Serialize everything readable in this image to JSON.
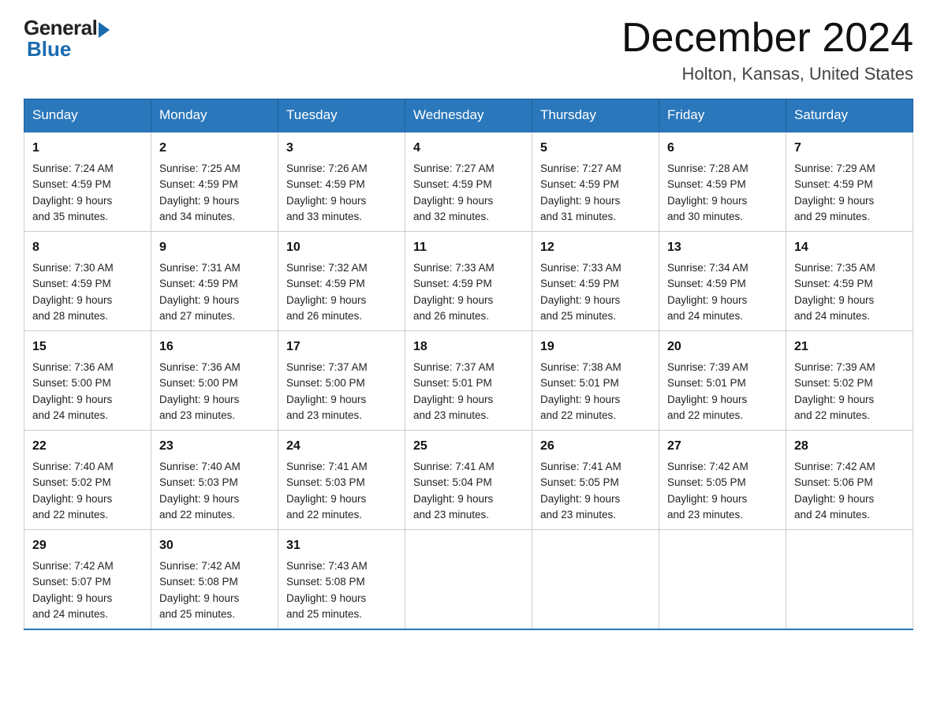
{
  "logo": {
    "general": "General",
    "blue": "Blue"
  },
  "header": {
    "month": "December 2024",
    "location": "Holton, Kansas, United States"
  },
  "days_of_week": [
    "Sunday",
    "Monday",
    "Tuesday",
    "Wednesday",
    "Thursday",
    "Friday",
    "Saturday"
  ],
  "weeks": [
    [
      {
        "day": "1",
        "sunrise": "7:24 AM",
        "sunset": "4:59 PM",
        "daylight": "9 hours and 35 minutes."
      },
      {
        "day": "2",
        "sunrise": "7:25 AM",
        "sunset": "4:59 PM",
        "daylight": "9 hours and 34 minutes."
      },
      {
        "day": "3",
        "sunrise": "7:26 AM",
        "sunset": "4:59 PM",
        "daylight": "9 hours and 33 minutes."
      },
      {
        "day": "4",
        "sunrise": "7:27 AM",
        "sunset": "4:59 PM",
        "daylight": "9 hours and 32 minutes."
      },
      {
        "day": "5",
        "sunrise": "7:27 AM",
        "sunset": "4:59 PM",
        "daylight": "9 hours and 31 minutes."
      },
      {
        "day": "6",
        "sunrise": "7:28 AM",
        "sunset": "4:59 PM",
        "daylight": "9 hours and 30 minutes."
      },
      {
        "day": "7",
        "sunrise": "7:29 AM",
        "sunset": "4:59 PM",
        "daylight": "9 hours and 29 minutes."
      }
    ],
    [
      {
        "day": "8",
        "sunrise": "7:30 AM",
        "sunset": "4:59 PM",
        "daylight": "9 hours and 28 minutes."
      },
      {
        "day": "9",
        "sunrise": "7:31 AM",
        "sunset": "4:59 PM",
        "daylight": "9 hours and 27 minutes."
      },
      {
        "day": "10",
        "sunrise": "7:32 AM",
        "sunset": "4:59 PM",
        "daylight": "9 hours and 26 minutes."
      },
      {
        "day": "11",
        "sunrise": "7:33 AM",
        "sunset": "4:59 PM",
        "daylight": "9 hours and 26 minutes."
      },
      {
        "day": "12",
        "sunrise": "7:33 AM",
        "sunset": "4:59 PM",
        "daylight": "9 hours and 25 minutes."
      },
      {
        "day": "13",
        "sunrise": "7:34 AM",
        "sunset": "4:59 PM",
        "daylight": "9 hours and 24 minutes."
      },
      {
        "day": "14",
        "sunrise": "7:35 AM",
        "sunset": "4:59 PM",
        "daylight": "9 hours and 24 minutes."
      }
    ],
    [
      {
        "day": "15",
        "sunrise": "7:36 AM",
        "sunset": "5:00 PM",
        "daylight": "9 hours and 24 minutes."
      },
      {
        "day": "16",
        "sunrise": "7:36 AM",
        "sunset": "5:00 PM",
        "daylight": "9 hours and 23 minutes."
      },
      {
        "day": "17",
        "sunrise": "7:37 AM",
        "sunset": "5:00 PM",
        "daylight": "9 hours and 23 minutes."
      },
      {
        "day": "18",
        "sunrise": "7:37 AM",
        "sunset": "5:01 PM",
        "daylight": "9 hours and 23 minutes."
      },
      {
        "day": "19",
        "sunrise": "7:38 AM",
        "sunset": "5:01 PM",
        "daylight": "9 hours and 22 minutes."
      },
      {
        "day": "20",
        "sunrise": "7:39 AM",
        "sunset": "5:01 PM",
        "daylight": "9 hours and 22 minutes."
      },
      {
        "day": "21",
        "sunrise": "7:39 AM",
        "sunset": "5:02 PM",
        "daylight": "9 hours and 22 minutes."
      }
    ],
    [
      {
        "day": "22",
        "sunrise": "7:40 AM",
        "sunset": "5:02 PM",
        "daylight": "9 hours and 22 minutes."
      },
      {
        "day": "23",
        "sunrise": "7:40 AM",
        "sunset": "5:03 PM",
        "daylight": "9 hours and 22 minutes."
      },
      {
        "day": "24",
        "sunrise": "7:41 AM",
        "sunset": "5:03 PM",
        "daylight": "9 hours and 22 minutes."
      },
      {
        "day": "25",
        "sunrise": "7:41 AM",
        "sunset": "5:04 PM",
        "daylight": "9 hours and 23 minutes."
      },
      {
        "day": "26",
        "sunrise": "7:41 AM",
        "sunset": "5:05 PM",
        "daylight": "9 hours and 23 minutes."
      },
      {
        "day": "27",
        "sunrise": "7:42 AM",
        "sunset": "5:05 PM",
        "daylight": "9 hours and 23 minutes."
      },
      {
        "day": "28",
        "sunrise": "7:42 AM",
        "sunset": "5:06 PM",
        "daylight": "9 hours and 24 minutes."
      }
    ],
    [
      {
        "day": "29",
        "sunrise": "7:42 AM",
        "sunset": "5:07 PM",
        "daylight": "9 hours and 24 minutes."
      },
      {
        "day": "30",
        "sunrise": "7:42 AM",
        "sunset": "5:08 PM",
        "daylight": "9 hours and 25 minutes."
      },
      {
        "day": "31",
        "sunrise": "7:43 AM",
        "sunset": "5:08 PM",
        "daylight": "9 hours and 25 minutes."
      },
      null,
      null,
      null,
      null
    ]
  ],
  "labels": {
    "sunrise": "Sunrise:",
    "sunset": "Sunset:",
    "daylight": "Daylight:"
  }
}
